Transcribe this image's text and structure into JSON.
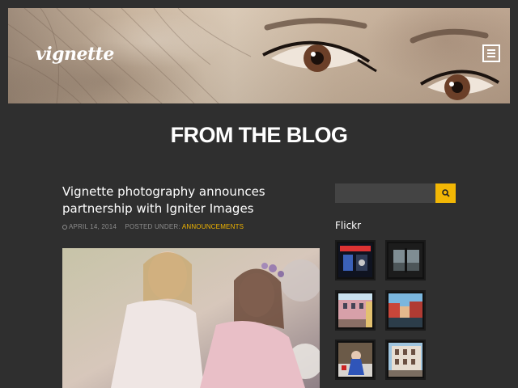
{
  "header": {
    "logo_text": "vignette",
    "menu_icon": "menu-icon",
    "banner_image": "woman-eyes-closeup"
  },
  "section": {
    "title": "FROM THE BLOG"
  },
  "post": {
    "title": "Vignette photography announces partnership with Igniter Images",
    "date": "APRIL 14, 2014",
    "posted_under_label": "POSTED UNDER:",
    "category": "ANNOUNCEMENTS",
    "image": "two-women-in-dresses"
  },
  "sidebar": {
    "search": {
      "value": "",
      "placeholder": "",
      "button_icon": "search-icon"
    },
    "flickr": {
      "title": "Flickr",
      "thumbnails": [
        "night-storefront-photo",
        "window-city-view-photo",
        "pink-building-photo",
        "red-houses-canal-photo",
        "blue-winter-figure-photo",
        "white-building-photo"
      ]
    }
  },
  "colors": {
    "background": "#2f2f2f",
    "accent": "#f2b705",
    "meta_text": "#8d8d8d"
  }
}
